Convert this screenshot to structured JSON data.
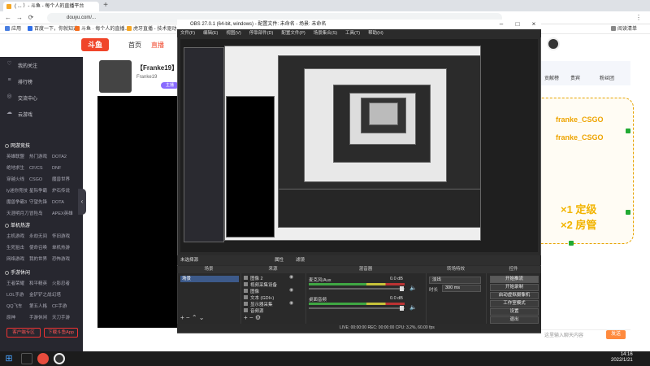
{
  "browser": {
    "tab_title": "( ... ）- 斗鱼 - 每个人的直播平台",
    "url": "douyu.com/...",
    "bookmarks": [
      "应用",
      "百度一下，你就知道",
      "斗鱼 · 每个人的直播...",
      "虎牙直播 - 技术驱动...",
      "阅读清单"
    ]
  },
  "site": {
    "logo": "斗鱼",
    "nav": [
      "首页",
      "直播"
    ],
    "sidebar": {
      "items": [
        {
          "icon": "heart-icon",
          "label": "我的关注"
        },
        {
          "icon": "list-icon",
          "label": "排行榜"
        },
        {
          "icon": "chat-icon",
          "label": "交流中心"
        },
        {
          "icon": "cloud-icon",
          "label": "云游戏"
        }
      ],
      "sections": [
        {
          "title": "网游竞技",
          "games": [
            "英雄联盟",
            "热门游戏",
            "DOTA2",
            "绝地求生",
            "CF/CS",
            "DNF",
            "穿越火线",
            "CSGO",
            "魔兽世界",
            "ly迷你竞技",
            "星际争霸",
            "炉石传说",
            "魔兽争霸3",
            "守望先锋",
            "DOTA",
            "天涯明月刀",
            "冒险岛",
            "APEX英雄"
          ]
        },
        {
          "title": "单机热游",
          "games": [
            "主机游戏",
            "永劫无间",
            "怀旧游戏",
            "生死狙击",
            "使命召唤",
            "单机热游",
            "网络游戏",
            "我的世界",
            "恐怖游戏"
          ]
        },
        {
          "title": "手游休闲",
          "games": [
            "王者荣耀",
            "和平精英",
            "火影忍者",
            "LOL手游",
            "金铲铲之战",
            "幻塔",
            "QQ飞车",
            "第五人格",
            "CF手游",
            "原神",
            "手游休闲",
            "天刀手游"
          ]
        }
      ],
      "buttons": [
        "客户端专区",
        "下载斗鱼App"
      ]
    },
    "stream": {
      "title": "【Franke19】讲...",
      "subtitle": "Franke19",
      "tag": "主播"
    },
    "right_panel": {
      "tabs": [
        "贡献榜",
        "贵宾",
        "粉丝团"
      ],
      "promo_lines": [
        "franke_CSGO",
        "franke_CSGO",
        "×1 定级",
        "×2 房管"
      ],
      "chat_placeholder": "这里输入聊天内容",
      "send": "发送"
    }
  },
  "obs": {
    "title": "OBS 27.0.1 (64-bit, windows) - 配置文件: 未命名 - 场景: 未命名",
    "menu": [
      "文件(F)",
      "编辑(E)",
      "视图(V)",
      "停靠部件(D)",
      "配置文件(P)",
      "场景集合(S)",
      "工具(T)",
      "帮助(H)"
    ],
    "dock_header": "未选择源",
    "dock_tabs": [
      "属性",
      "滤镜"
    ],
    "panels": {
      "scenes": {
        "title": "场景",
        "items": [
          "场景"
        ]
      },
      "sources": {
        "title": "来源",
        "items": [
          "图像 2",
          "视频采集设备",
          "图像",
          "文本 (GDI+)",
          "显示器采集",
          "音频源"
        ]
      },
      "mixer": {
        "title": "混音器",
        "tracks": [
          {
            "name": "麦克风/Aux",
            "level": "0.0 dB"
          },
          {
            "name": "桌面音频",
            "level": "0.0 dB"
          }
        ]
      },
      "transitions": {
        "title": "转场特效",
        "type": "淡出",
        "duration_label": "时长",
        "duration": "300 ms"
      },
      "controls": {
        "title": "控件",
        "buttons": [
          "开始推流",
          "开始录制",
          "启动虚拟摄像机",
          "工作室模式",
          "设置",
          "退出"
        ]
      }
    },
    "status": "LIVE: 00:00:00   REC: 00:00:00   CPU: 3.2%, 60.00 fps"
  },
  "taskbar": {
    "time": "14:16",
    "date": "2022/1/21"
  }
}
